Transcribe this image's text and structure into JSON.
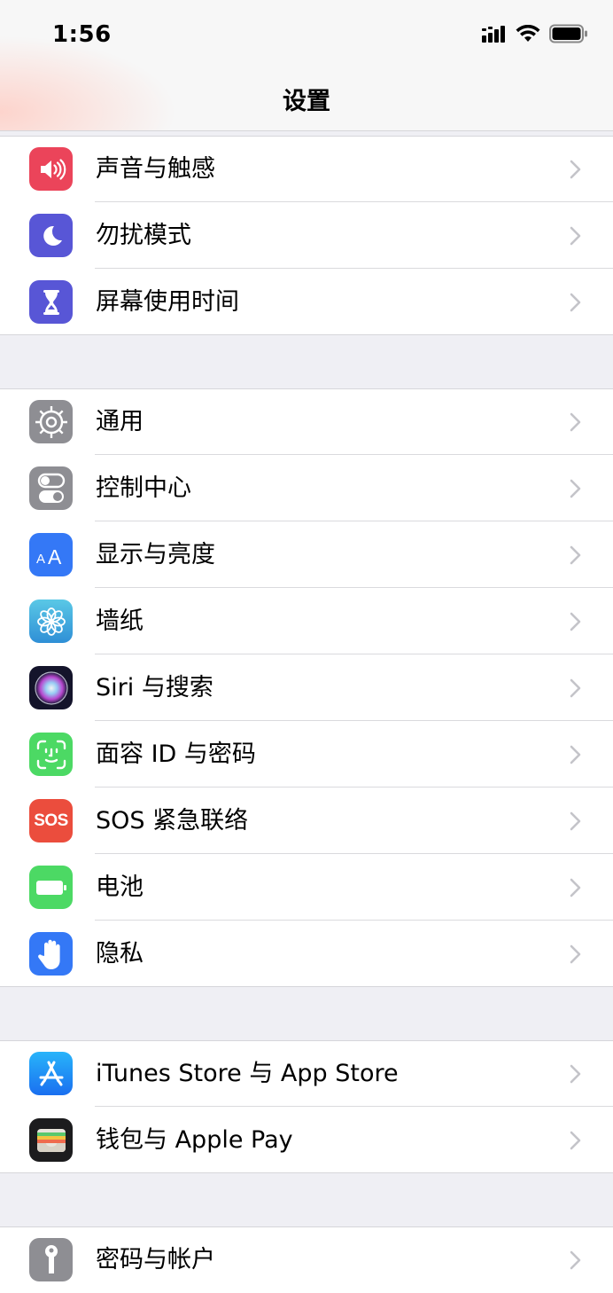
{
  "status_bar": {
    "time": "1:56"
  },
  "nav": {
    "title": "设置"
  },
  "groups": [
    {
      "items": [
        {
          "label": "声音与触感",
          "icon": "speaker-icon",
          "color": "#eb445a"
        },
        {
          "label": "勿扰模式",
          "icon": "moon-icon",
          "color": "#5856d6"
        },
        {
          "label": "屏幕使用时间",
          "icon": "hourglass-icon",
          "color": "#5856d6"
        }
      ]
    },
    {
      "items": [
        {
          "label": "通用",
          "icon": "gear-icon",
          "color": "#8e8e93"
        },
        {
          "label": "控制中心",
          "icon": "toggles-icon",
          "color": "#8e8e93"
        },
        {
          "label": "显示与亮度",
          "icon": "text-size-icon",
          "color": "#3478f6"
        },
        {
          "label": "墙纸",
          "icon": "flower-icon",
          "color": "#37aadc"
        },
        {
          "label": "Siri 与搜索",
          "icon": "siri-icon",
          "color": "#1c1c3a"
        },
        {
          "label": "面容 ID 与密码",
          "icon": "face-id-icon",
          "color": "#4cd964"
        },
        {
          "label": "SOS 紧急联络",
          "icon": "sos-icon",
          "color": "#eb4d3d",
          "icon_text": "SOS"
        },
        {
          "label": "电池",
          "icon": "battery-icon",
          "color": "#4cd964"
        },
        {
          "label": "隐私",
          "icon": "hand-icon",
          "color": "#3478f6"
        }
      ]
    },
    {
      "items": [
        {
          "label": "iTunes Store 与 App Store",
          "icon": "app-store-icon",
          "color": "#1a8cf0"
        },
        {
          "label": "钱包与 Apple Pay",
          "icon": "wallet-icon",
          "color": "#1c1c1e"
        }
      ]
    },
    {
      "items": [
        {
          "label": "密码与帐户",
          "icon": "key-icon",
          "color": "#8e8e93"
        }
      ]
    }
  ]
}
